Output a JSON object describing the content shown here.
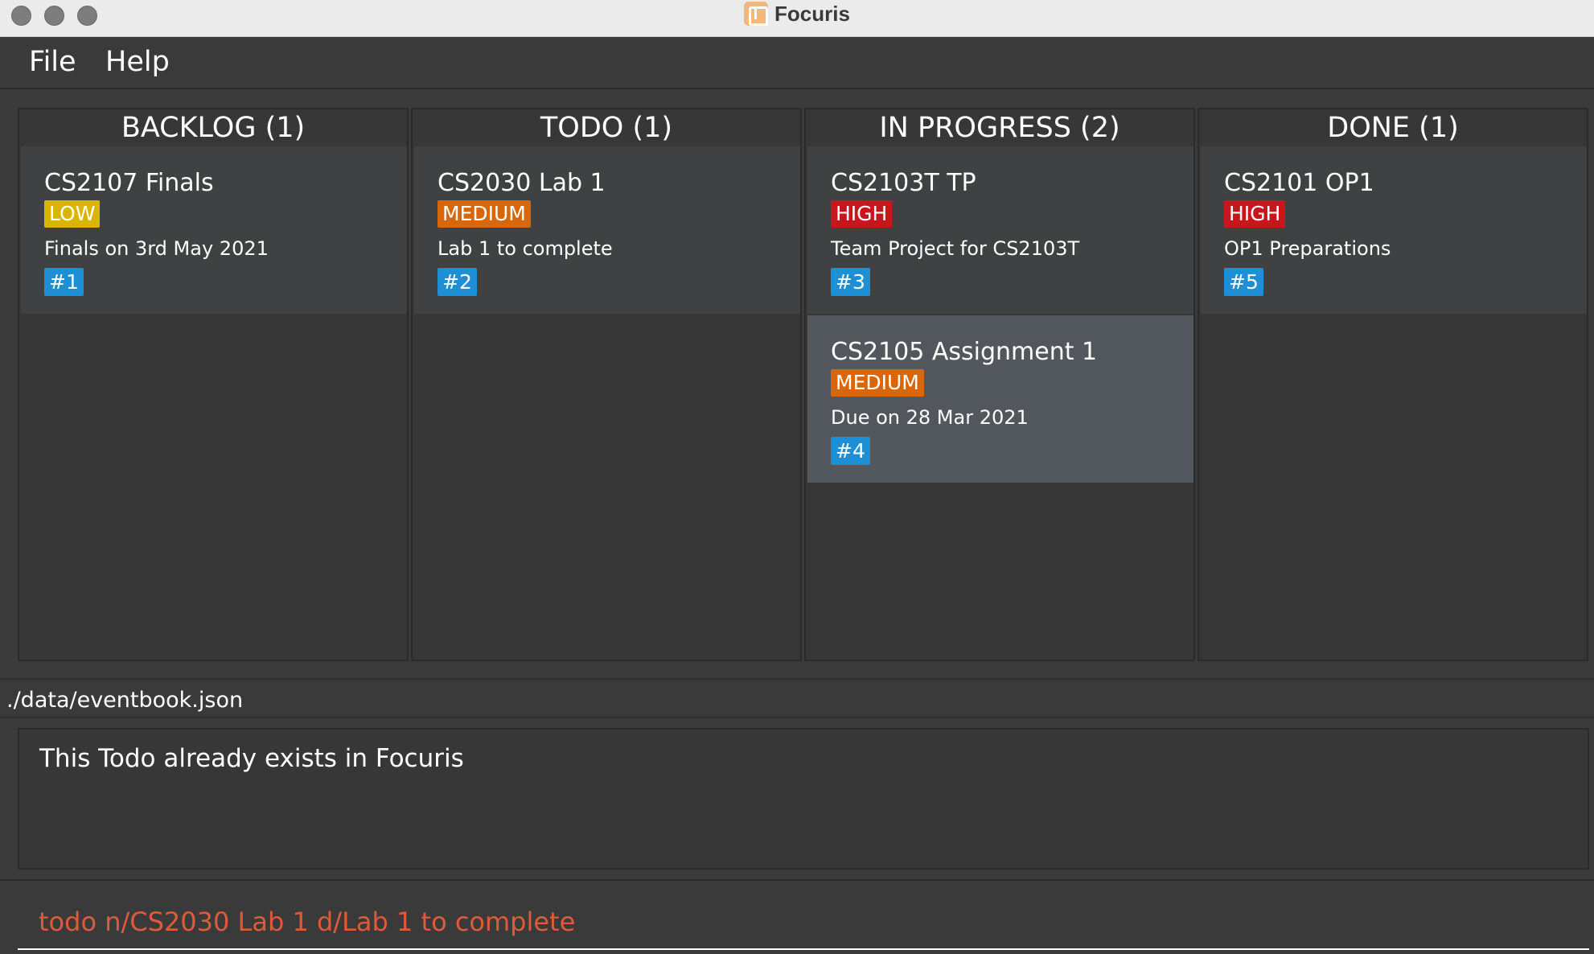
{
  "window": {
    "title": "Focuris"
  },
  "menu": {
    "file": "File",
    "help": "Help"
  },
  "columns": [
    {
      "header": "BACKLOG (1)",
      "cards": [
        {
          "title": "CS2107 Finals",
          "priority": "LOW",
          "description": "Finals on 3rd May 2021",
          "id": "#1"
        }
      ]
    },
    {
      "header": "TODO (1)",
      "cards": [
        {
          "title": "CS2030 Lab 1",
          "priority": "MEDIUM",
          "description": "Lab 1 to complete",
          "id": "#2"
        }
      ]
    },
    {
      "header": "IN PROGRESS (2)",
      "cards": [
        {
          "title": "CS2103T TP",
          "priority": "HIGH",
          "description": "Team Project for CS2103T",
          "id": "#3"
        },
        {
          "title": "CS2105 Assignment 1",
          "priority": "MEDIUM",
          "description": "Due on 28 Mar 2021",
          "id": "#4"
        }
      ]
    },
    {
      "header": "DONE (1)",
      "cards": [
        {
          "title": "CS2101 OP1",
          "priority": "HIGH",
          "description": "OP1 Preparations",
          "id": "#5"
        }
      ]
    }
  ],
  "status": {
    "file_path": "./data/eventbook.json"
  },
  "result": {
    "message": "This Todo already exists in Focuris"
  },
  "command": {
    "value": "todo n/CS2030 Lab 1 d/Lab 1 to complete"
  },
  "colors": {
    "low": "#d9b500",
    "medium": "#d9670a",
    "high": "#c8161d",
    "id_badge": "#1e8fd4",
    "command_text": "#e05a3a"
  }
}
